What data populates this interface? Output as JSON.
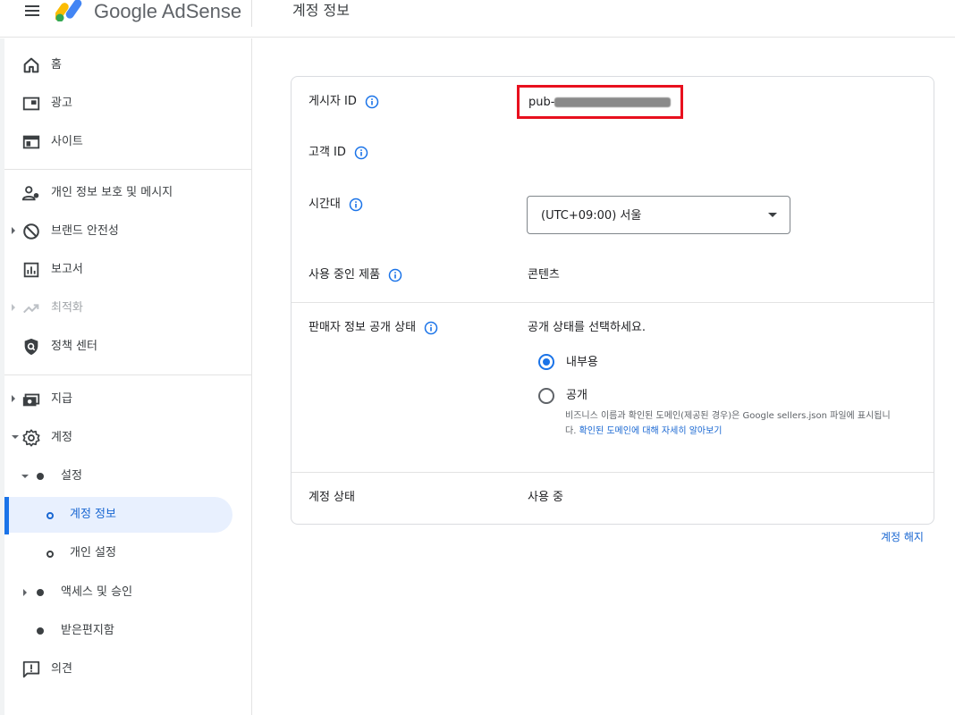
{
  "header": {
    "product_name": "Google AdSense",
    "page_title": "계정 정보"
  },
  "sidebar": {
    "items": [
      {
        "label": "홈",
        "icon": "home-icon"
      },
      {
        "label": "광고",
        "icon": "ads-icon"
      },
      {
        "label": "사이트",
        "icon": "sites-icon"
      },
      {
        "label": "개인 정보 보호 및 메시지",
        "icon": "privacy-icon"
      },
      {
        "label": "브랜드 안전성",
        "icon": "block-icon"
      },
      {
        "label": "보고서",
        "icon": "reports-icon"
      },
      {
        "label": "최적화",
        "icon": "trending-icon"
      },
      {
        "label": "정책 센터",
        "icon": "policy-shield-icon"
      },
      {
        "label": "지급",
        "icon": "payments-icon"
      },
      {
        "label": "계정",
        "icon": "gear-icon"
      },
      {
        "label": "설정"
      },
      {
        "label": "계정 정보"
      },
      {
        "label": "개인 설정"
      },
      {
        "label": "액세스 및 승인"
      },
      {
        "label": "받은편지함"
      },
      {
        "label": "의견",
        "icon": "feedback-icon"
      }
    ]
  },
  "account": {
    "publisher_id_label": "게시자 ID",
    "publisher_id_value": "pub-",
    "customer_id_label": "고객 ID",
    "timezone_label": "시간대",
    "timezone_value": "(UTC+09:00) 서울",
    "products_label": "사용 중인 제품",
    "products_value": "콘텐츠",
    "seller_info_label": "판매자 정보 공개 상태",
    "seller_info_prompt": "공개 상태를 선택하세요.",
    "option_internal": "내부용",
    "option_public": "공개",
    "helper_text": "비즈니스 이름과 확인된 도메인(제공된 경우)은 Google sellers.json 파일에 표시됩니다.",
    "helper_link": "확인된 도메인에 대해 자세히 알아보기",
    "status_label": "계정 상태",
    "status_value": "사용 중",
    "close_account": "계정 해지"
  },
  "colors": {
    "accent": "#1a73e8",
    "highlight_box": "#e8101e",
    "active_nav_bg": "#e8f0fe"
  }
}
